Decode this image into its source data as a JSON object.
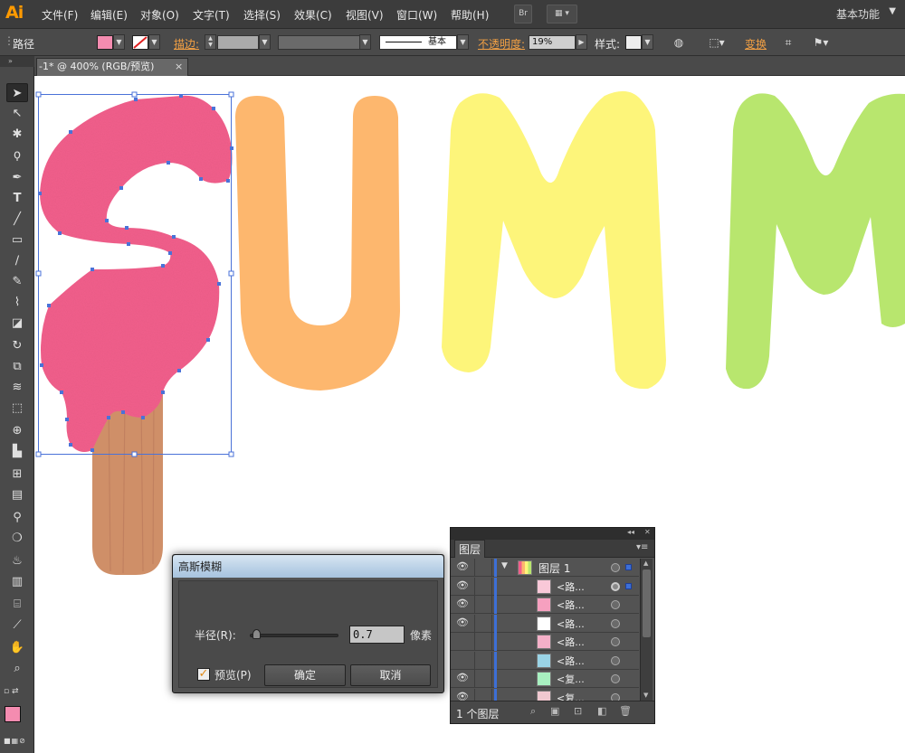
{
  "app": {
    "logo": "Ai",
    "menus": [
      "文件(F)",
      "编辑(E)",
      "对象(O)",
      "文字(T)",
      "选择(S)",
      "效果(C)",
      "视图(V)",
      "窗口(W)",
      "帮助(H)"
    ],
    "bridge_label": "Br",
    "workspace": "基本功能"
  },
  "control_bar": {
    "object_type": "路径",
    "stroke_label": "描边:",
    "stroke_profile": "基本",
    "opacity_label": "不透明度:",
    "opacity_value": "19%",
    "style_label": "样式:",
    "transform_label": "变换",
    "fill_color": "#f48cb0"
  },
  "document": {
    "tab_title": "-1* @ 400% (RGB/预览)",
    "close_glyph": "×"
  },
  "tools_header": "»",
  "artwork": {
    "colors": {
      "s_pink": "#f25f8c",
      "u_orange": "#fdb76e",
      "m_yellow": "#fdf57a",
      "m_green": "#b8e66e",
      "stick": "#cf8f68",
      "selection": "#4a72d8"
    }
  },
  "dialog": {
    "title": "高斯模糊",
    "radius_label": "半径(R):",
    "radius_value": "0.7",
    "unit": "像素",
    "preview_label": "预览(P)",
    "ok": "确定",
    "cancel": "取消",
    "slider_fraction": 0.03
  },
  "layers_panel": {
    "tab": "图层",
    "rows": [
      {
        "name": "图层 1",
        "visible": true
      },
      {
        "name": "<路...",
        "visible": true
      },
      {
        "name": "<路...",
        "visible": true
      },
      {
        "name": "<路...",
        "visible": true
      },
      {
        "name": "<路...",
        "visible": false
      },
      {
        "name": "<路...",
        "visible": false
      },
      {
        "name": "<复...",
        "visible": true
      },
      {
        "name": "<复...",
        "visible": true
      }
    ],
    "footer": "1 个图层"
  }
}
